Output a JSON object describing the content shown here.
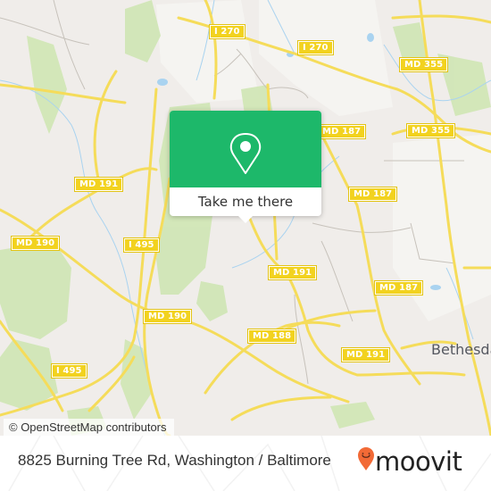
{
  "map": {
    "shields": [
      {
        "id": "i270-west",
        "label": "I 270"
      },
      {
        "id": "i270-east",
        "label": "I 270"
      },
      {
        "id": "md355-north",
        "label": "MD 355"
      },
      {
        "id": "md355-south",
        "label": "MD 355"
      },
      {
        "id": "md187-north",
        "label": "MD 187"
      },
      {
        "id": "md191-west",
        "label": "MD 191"
      },
      {
        "id": "md187-mid",
        "label": "MD 187"
      },
      {
        "id": "md190-west",
        "label": "MD 190"
      },
      {
        "id": "i495-north",
        "label": "I 495"
      },
      {
        "id": "md191-mid",
        "label": "MD 191"
      },
      {
        "id": "md187-south",
        "label": "MD 187"
      },
      {
        "id": "md190-mid",
        "label": "MD 190"
      },
      {
        "id": "md188",
        "label": "MD 188"
      },
      {
        "id": "md191-south",
        "label": "MD 191"
      },
      {
        "id": "i495-south",
        "label": "I 495"
      }
    ],
    "places": [
      {
        "id": "bethesda",
        "label": "Bethesda"
      }
    ],
    "attribution": "© OpenStreetMap contributors",
    "colors": {
      "land": "#f0edea",
      "park": "#cfe6b4",
      "road": "#f5dc5a",
      "water": "#a9d3f0",
      "shield": "#f2d21f"
    }
  },
  "popup": {
    "icon": "map-pin-icon",
    "action_label": "Take me there",
    "color": "#1db86a"
  },
  "footer": {
    "address": "8825 Burning Tree Rd, Washington / Baltimore",
    "brand": "moovit",
    "brand_color": "#f26a36"
  }
}
